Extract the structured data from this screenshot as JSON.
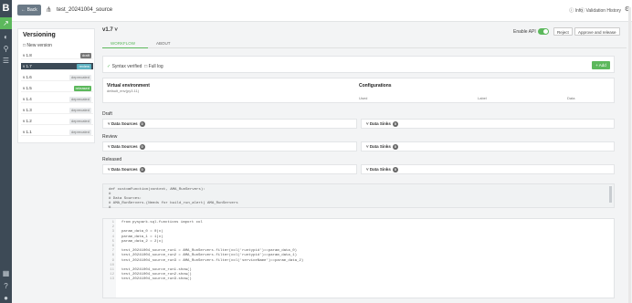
{
  "topbar": {
    "back": "Back",
    "title": "test_20241004_source",
    "info": "Info",
    "history": "Validation History"
  },
  "sidebar": {
    "title": "Versioning",
    "new_version": "New version",
    "items": [
      {
        "label": "v 1.8",
        "badge": "draft",
        "type": "draft"
      },
      {
        "label": "v 1.7",
        "badge": "review",
        "type": "active"
      },
      {
        "label": "v 1.6",
        "badge": "deprecated",
        "type": "dep"
      },
      {
        "label": "v 1.5",
        "badge": "released",
        "type": "released"
      },
      {
        "label": "v 1.4",
        "badge": "deprecated",
        "type": "dep"
      },
      {
        "label": "v 1.3",
        "badge": "deprecated",
        "type": "dep"
      },
      {
        "label": "v 1.2",
        "badge": "deprecated",
        "type": "dep"
      },
      {
        "label": "v 1.1",
        "badge": "deprecated",
        "type": "dep"
      }
    ]
  },
  "main": {
    "version": "v1.7",
    "enable_api": "Enable API",
    "reject": "Reject",
    "approve": "Approve and release",
    "tabs": [
      "WORKFLOW",
      "ABOUT"
    ],
    "syntax": "Syntax verified",
    "full_log": "Full log",
    "add": "+ Add",
    "virtual_env": "Virtual environment",
    "virtual_env_value": "default_env(py3.11)",
    "configurations": "Configurations",
    "cfg_cols": [
      "Used",
      "Label",
      "Data"
    ],
    "sections": [
      "Draft",
      "Review",
      "Released"
    ],
    "data_sources": "Data Sources",
    "data_sinks": "Data Sinks",
    "count": "0"
  },
  "code_header": [
    "def customFunction(context, AMA_RunServers):",
    "#",
    "# Data Sources:",
    "# AMA_RunServers.(Needs for build_run_alert) AMA_RunServers",
    "#"
  ],
  "code_lines": [
    "from pyspark.sql.functions import col",
    "",
    "param_data_0 = 0(x)",
    "param_data_1 = 1(x)",
    "param_data_2 = 2(x)",
    "",
    "test_20241004_source_run1 = AMA_RunServers.filter(col('runtypid')==param_data_0)",
    "test_20241004_source_run2 = AMA_RunServers.filter(col('runtypid')==param_data_1)",
    "test_20241004_source_run3 = AMA_RunServers.filter(col('serviceName')==param_data_2)",
    "",
    "test_20241004_source_run1.show()",
    "test_20241004_source_run2.show()",
    "test_20241004_source_run3.show()"
  ]
}
